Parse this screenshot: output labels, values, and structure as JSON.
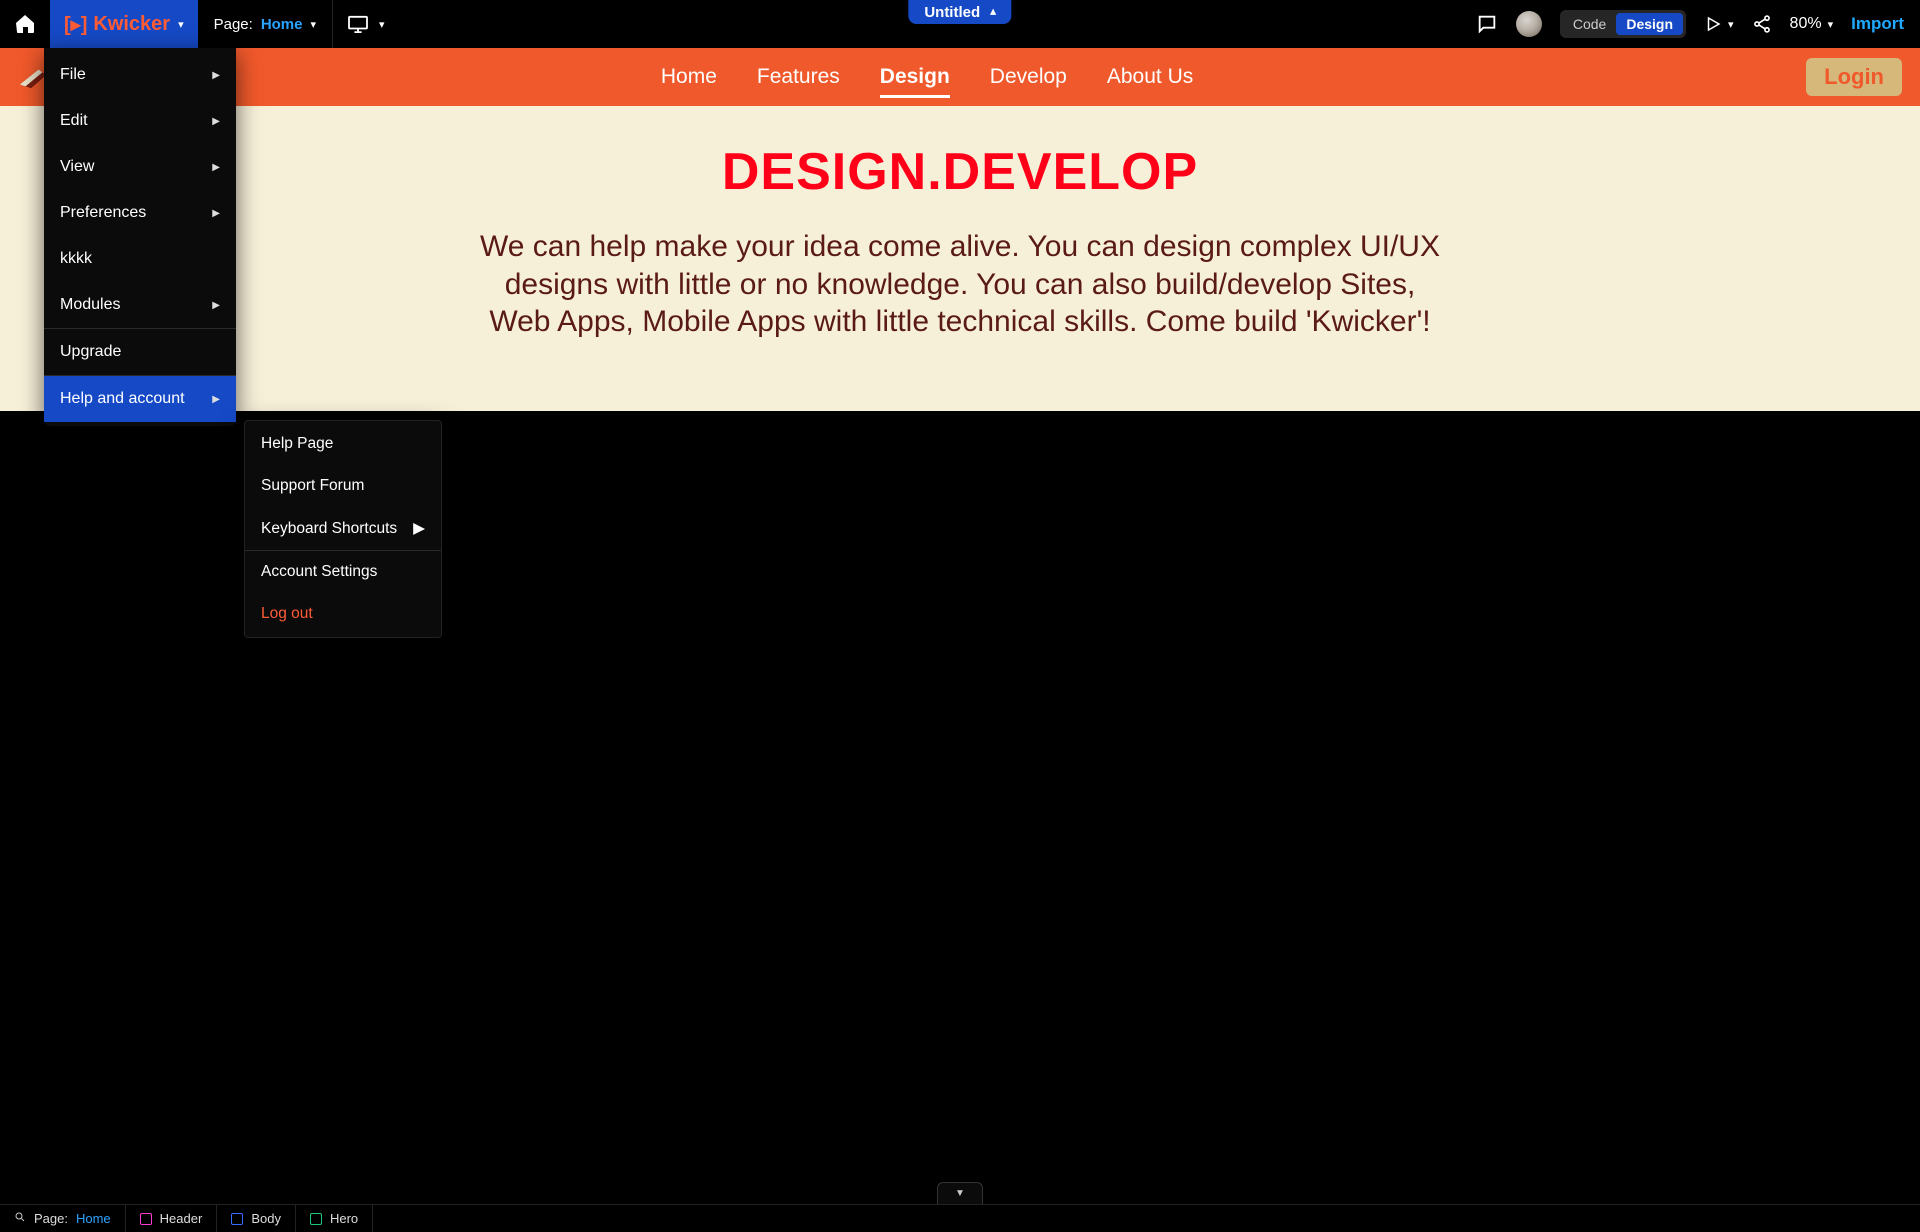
{
  "topbar": {
    "brand": "Kwicker",
    "page_label": "Page:",
    "page_value": "Home",
    "title": "Untitled",
    "mode_code": "Code",
    "mode_design": "Design",
    "zoom": "80%",
    "import": "Import"
  },
  "menu": {
    "items": [
      {
        "label": "File",
        "arrow": true
      },
      {
        "label": "Edit",
        "arrow": true
      },
      {
        "label": "View",
        "arrow": true
      },
      {
        "label": "Preferences",
        "arrow": true
      },
      {
        "label": "kkkk",
        "arrow": false
      },
      {
        "label": "Modules",
        "arrow": true
      },
      {
        "label": "Upgrade",
        "arrow": false,
        "sep": true
      },
      {
        "label": "Help and account",
        "arrow": true,
        "highlight": true,
        "sep": true
      }
    ]
  },
  "submenu": {
    "items": [
      {
        "label": "Help Page"
      },
      {
        "label": "Support Forum"
      },
      {
        "label": "Keyboard Shortcuts",
        "arrow": true
      },
      {
        "label": "Account Settings",
        "sep": true
      },
      {
        "label": "Log out",
        "danger": true
      }
    ]
  },
  "site": {
    "nav": [
      "Home",
      "Features",
      "Design",
      "Develop",
      "About Us"
    ],
    "nav_active": 2,
    "login": "Login",
    "hero_title": "DESIGN.DEVELOP",
    "hero_body": "We can help make your idea come alive. You can design complex UI/UX designs with little or no knowledge. You can also build/develop Sites, Web Apps, Mobile Apps with little technical skills. Come build 'Kwicker'!"
  },
  "breadcrumb": {
    "page_label": "Page:",
    "page_value": "Home",
    "items": [
      {
        "label": "Header",
        "color": "#ff3bd4"
      },
      {
        "label": "Body",
        "color": "#3b6bff"
      },
      {
        "label": "Hero",
        "color": "#18c97a"
      }
    ]
  }
}
